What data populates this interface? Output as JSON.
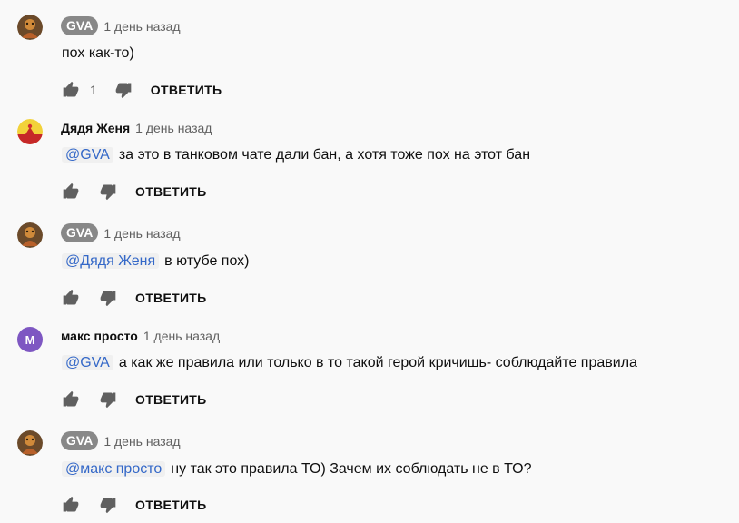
{
  "comments": [
    {
      "author": "GVA",
      "author_style": "badge",
      "avatar": "gva-avatar-icon",
      "time": "1 день назад",
      "mention": "",
      "text": "пох как-то)",
      "likes": "1",
      "reply_label": "ОТВЕТИТЬ"
    },
    {
      "author": "Дядя Женя",
      "author_style": "plain",
      "avatar": "flag-emblem-avatar-icon",
      "time": "1 день назад",
      "mention": "@GVA",
      "text": "за это в танковом чате дали бан, а хотя тоже пох на этот бан",
      "likes": "",
      "reply_label": "ОТВЕТИТЬ"
    },
    {
      "author": "GVA",
      "author_style": "badge",
      "avatar": "gva-avatar-icon",
      "time": "1 день назад",
      "mention": "@Дядя Женя",
      "text": "в ютубе пох)",
      "likes": "",
      "reply_label": "ОТВЕТИТЬ"
    },
    {
      "author": "макс просто",
      "author_style": "plain",
      "avatar": "letter-avatar",
      "avatar_letter": "М",
      "time": "1 день назад",
      "mention": "@GVA",
      "text": "а как же правила или только в то такой герой кричишь-  соблюдайте правила",
      "likes": "",
      "reply_label": "ОТВЕТИТЬ"
    },
    {
      "author": "GVA",
      "author_style": "badge",
      "avatar": "gva-avatar-icon",
      "time": "1 день назад",
      "mention": "@макс просто",
      "text": "ну так это правила ТО) Зачем их соблюдать не в ТО?",
      "likes": "",
      "reply_label": "ОТВЕТИТЬ"
    }
  ],
  "colors": {
    "background": "#f9f9f9",
    "mention": "#3468c8",
    "badge": "#888888",
    "avatar_letter_bg": "#7e57c2"
  }
}
